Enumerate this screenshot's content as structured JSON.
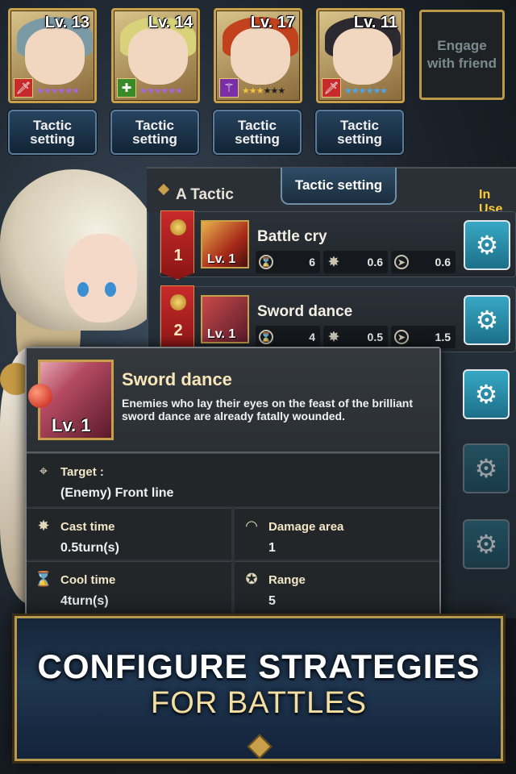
{
  "heroes": [
    {
      "level": "Lv. 13",
      "class_icon": "sword-icon",
      "class_color": "#c62a2a",
      "stars": "★★★★★★",
      "star_color": "#a765e6",
      "hair_color": "#7a9aa6"
    },
    {
      "level": "Lv. 14",
      "class_icon": "cross-icon",
      "class_color": "#3b8a2a",
      "stars": "★★★★★★",
      "star_color": "#a765e6",
      "hair_color": "#d8d27a"
    },
    {
      "level": "Lv. 17",
      "class_icon": "staff-icon",
      "class_color": "#7a2ea8",
      "stars": "★★★★★★",
      "star_color": "#f3c23a",
      "hair_color": "#c2421e"
    },
    {
      "level": "Lv. 11",
      "class_icon": "sword-icon",
      "class_color": "#c62a2a",
      "stars": "★★★★★★",
      "star_color": "#4aa6ee",
      "hair_color": "#2c2a30"
    }
  ],
  "tactic_button_label": "Tactic\nsetting",
  "engage_label": "Engage\nwith friend",
  "panel": {
    "title": "A Tactic",
    "tab": "Tactic setting",
    "status": "In Use"
  },
  "skills": [
    {
      "rank": "1",
      "name": "Battle cry",
      "level": "Lv. 1",
      "cooldown": "6",
      "cast": "0.6",
      "speed": "0.6"
    },
    {
      "rank": "2",
      "name": "Sword dance",
      "level": "Lv. 1",
      "cooldown": "4",
      "cast": "0.5",
      "speed": "1.5"
    }
  ],
  "tooltip": {
    "name": "Sword dance",
    "level": "Lv. 1",
    "description": "Enemies who lay their eyes on the feast of the brilliant sword dance are already fatally wounded.",
    "target_label": "Target :",
    "target_value": "(Enemy) Front line",
    "cast_label": "Cast time",
    "cast_value": "0.5turn(s)",
    "area_label": "Damage area",
    "area_value": "1",
    "cool_label": "Cool time",
    "cool_value": "4turn(s)",
    "range_label": "Range",
    "range_value": "5"
  },
  "banner": {
    "line1": "CONFIGURE STRATEGIES",
    "line2": "FOR BATTLES"
  },
  "colors": {
    "accent_gold": "#c9a04a",
    "in_use": "#ffcc33",
    "gear_button": "#2a93b0"
  }
}
